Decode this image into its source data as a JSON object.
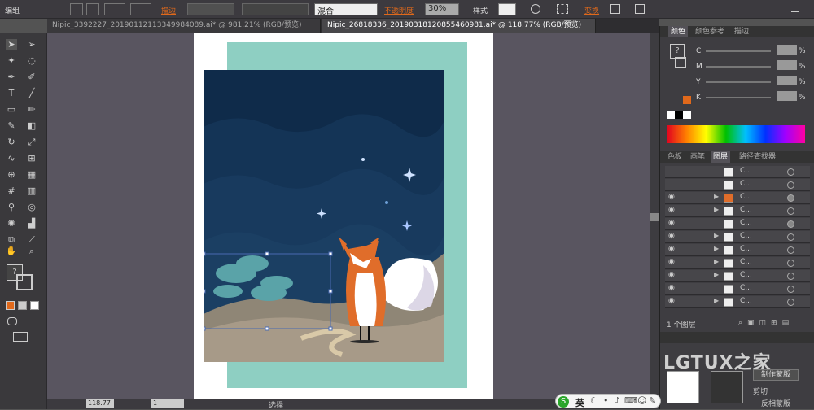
{
  "control_bar": {
    "group_label": "编组",
    "stroke_label": "描边",
    "blend_mode": "混合",
    "opacity_label": "不透明度",
    "opacity_value": "30%",
    "style_label": "样式",
    "transform_label": "变换"
  },
  "tabs": [
    {
      "label": "Nipic_3392227_20190112113349984089.ai* @ 981.21% (RGB/预览)"
    },
    {
      "label": "Nipic_26818336_20190318120855460981.ai* @ 118.77% (RGB/预览)"
    }
  ],
  "color_panel": {
    "tabs": [
      "颜色",
      "颜色参考",
      "描边"
    ],
    "sliders": [
      "C",
      "M",
      "Y",
      "K"
    ],
    "percent": "%"
  },
  "layers_panel": {
    "tabs": [
      "色板",
      "画笔",
      "图层",
      "路径查找器"
    ],
    "rows": [
      "C...",
      "C...",
      "C...",
      "C...",
      "C...",
      "C...",
      "C...",
      "C...",
      "C...",
      "C...",
      "C..."
    ],
    "footer": "1 个图层"
  },
  "bottom_panel": {
    "btn1": "制作蒙版",
    "btn2": "反相蒙版",
    "btn3": "剪切",
    "watermark": "LGTUX之家"
  },
  "status": {
    "zoom": "118.77",
    "page": "1",
    "tool": "选择"
  },
  "ime": {
    "lang": "英"
  },
  "colors": {
    "sky": "#0f2b4a",
    "teal_board": "#8ecfc2",
    "fox": "#e06d2a",
    "panel": "#3e3d41",
    "accent_orange": "#e0691b"
  }
}
